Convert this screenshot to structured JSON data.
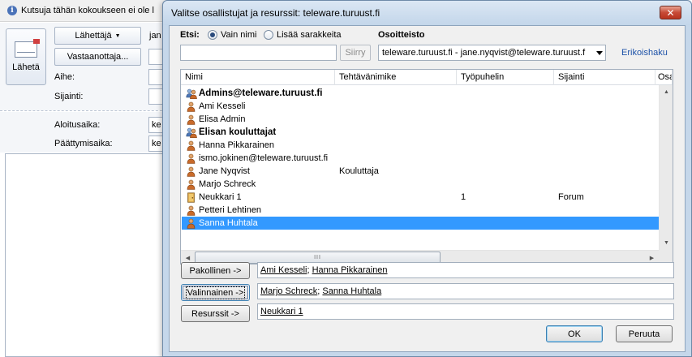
{
  "background_window": {
    "info_text": "Kutsuja tähän kokoukseen ei ole l",
    "send_label": "Lähetä",
    "from_label": "Lähettäjä",
    "from_value": "jan",
    "to_label": "Vastaanottaja...",
    "subject_label": "Aihe:",
    "location_label": "Sijainti:",
    "start_label": "Aloitusaika:",
    "start_value": "ke",
    "end_label": "Päättymisaika:",
    "end_value": "ke"
  },
  "dialog": {
    "title": "Valitse osallistujat ja resurssit: teleware.turuust.fi",
    "close_glyph": "✕",
    "search": {
      "label": "Etsi:",
      "radio_name_only": "Vain nimi",
      "radio_more_columns": "Lisää sarakkeita",
      "input_value": "",
      "go_label": "Siirry"
    },
    "address_book": {
      "label": "Osoitteisto",
      "selected": "teleware.turuust.fi - jane.nyqvist@teleware.turuust.f",
      "advanced_link": "Erikoishaku"
    },
    "columns": [
      "Nimi",
      "Tehtävänimike",
      "Työpuhelin",
      "Sijainti",
      "Osa"
    ],
    "rows": [
      {
        "name": "Admins@teleware.turuust.fi",
        "title": "",
        "phone": "",
        "location": "",
        "type": "group",
        "bold": true,
        "selected": false
      },
      {
        "name": "Ami Kesseli",
        "title": "",
        "phone": "",
        "location": "",
        "type": "user",
        "bold": false,
        "selected": false
      },
      {
        "name": "Elisa Admin",
        "title": "",
        "phone": "",
        "location": "",
        "type": "user",
        "bold": false,
        "selected": false
      },
      {
        "name": "Elisan kouluttajat",
        "title": "",
        "phone": "",
        "location": "",
        "type": "group",
        "bold": true,
        "selected": false
      },
      {
        "name": "Hanna Pikkarainen",
        "title": "",
        "phone": "",
        "location": "",
        "type": "user",
        "bold": false,
        "selected": false
      },
      {
        "name": "ismo.jokinen@teleware.turuust.fi",
        "title": "",
        "phone": "",
        "location": "",
        "type": "user",
        "bold": false,
        "selected": false
      },
      {
        "name": "Jane Nyqvist",
        "title": "Kouluttaja",
        "phone": "",
        "location": "",
        "type": "user",
        "bold": false,
        "selected": false
      },
      {
        "name": "Marjo Schreck",
        "title": "",
        "phone": "",
        "location": "",
        "type": "user",
        "bold": false,
        "selected": false
      },
      {
        "name": "Neukkari 1",
        "title": "",
        "phone": "1",
        "location": "Forum",
        "type": "room",
        "bold": false,
        "selected": false
      },
      {
        "name": "Petteri Lehtinen",
        "title": "",
        "phone": "",
        "location": "",
        "type": "user",
        "bold": false,
        "selected": false
      },
      {
        "name": "Sanna Huhtala",
        "title": "",
        "phone": "",
        "location": "",
        "type": "user",
        "bold": false,
        "selected": true
      }
    ],
    "hscroll_grip": "III",
    "required": {
      "button": "Pakollinen ->",
      "names": [
        "Ami Kesseli",
        "Hanna Pikkarainen"
      ]
    },
    "optional": {
      "button": "Valinnainen ->",
      "names": [
        "Marjo Schreck",
        "Sanna Huhtala"
      ]
    },
    "resources": {
      "button": "Resurssit ->",
      "names": [
        "Neukkari 1"
      ]
    },
    "ok_label": "OK",
    "cancel_label": "Peruuta"
  },
  "colors": {
    "selection": "#3399ff",
    "link": "#1d52a8",
    "dialog_frame": "#c5d7ea"
  },
  "icons": {
    "user": "user-icon",
    "group": "group-icon",
    "room": "room-icon",
    "info": "info-icon",
    "send": "envelope-icon"
  }
}
